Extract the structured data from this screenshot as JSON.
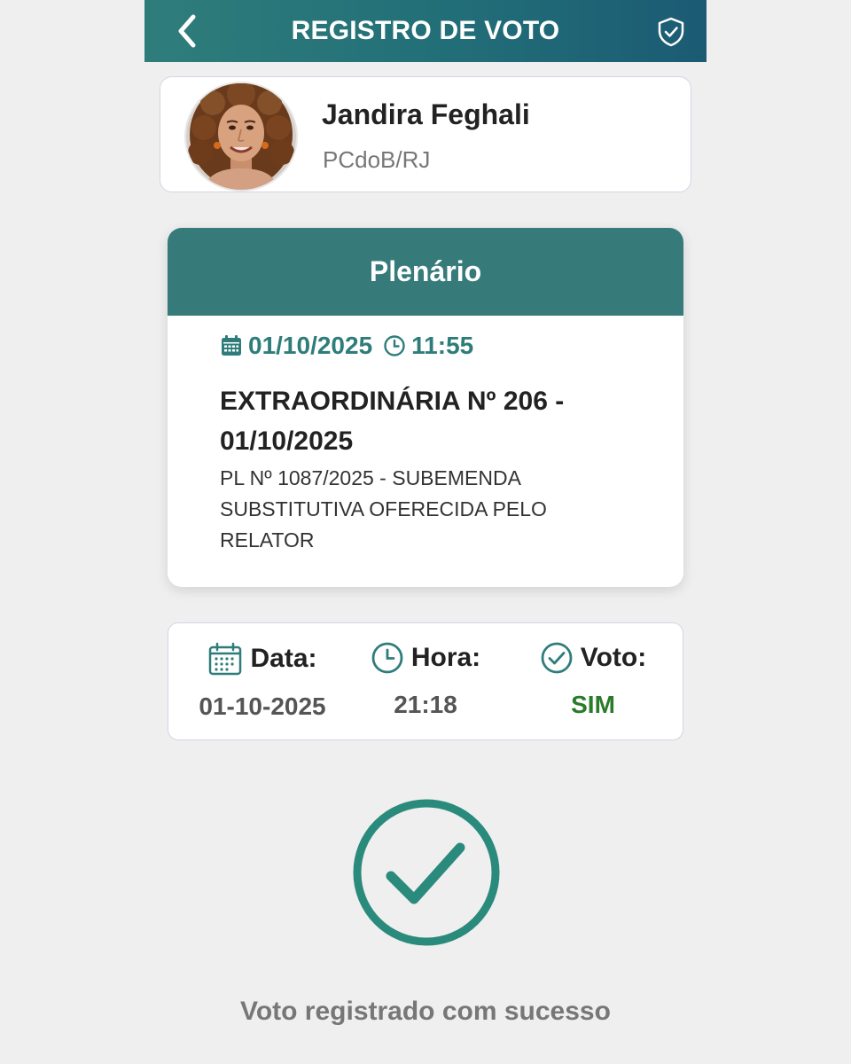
{
  "header": {
    "title": "REGISTRO DE VOTO",
    "back_icon": "chevron-left-icon",
    "right_icon": "shield-check-icon"
  },
  "profile": {
    "name": "Jandira Feghali",
    "party": "PCdoB/RJ"
  },
  "session": {
    "title": "Plenário",
    "date": "01/10/2025",
    "time": "11:55",
    "name": "EXTRAORDINÁRIA Nº 206 - 01/10/2025",
    "description": "PL Nº 1087/2025 - SUBEMENDA SUBSTITUTIVA OFERECIDA PELO RELATOR"
  },
  "vote_info": {
    "date_label": "Data:",
    "date_value": "01-10-2025",
    "time_label": "Hora:",
    "time_value": "21:18",
    "vote_label": "Voto:",
    "vote_value": "SIM"
  },
  "success": {
    "message": "Voto registrado com sucesso"
  },
  "colors": {
    "header_start": "#2f7d7b",
    "header_end": "#1b5b73",
    "session_header": "#367a7a",
    "accent_teal": "#2f7d7b",
    "vote_yes": "#2b7b2b",
    "success_circle": "#2a8a7c"
  }
}
